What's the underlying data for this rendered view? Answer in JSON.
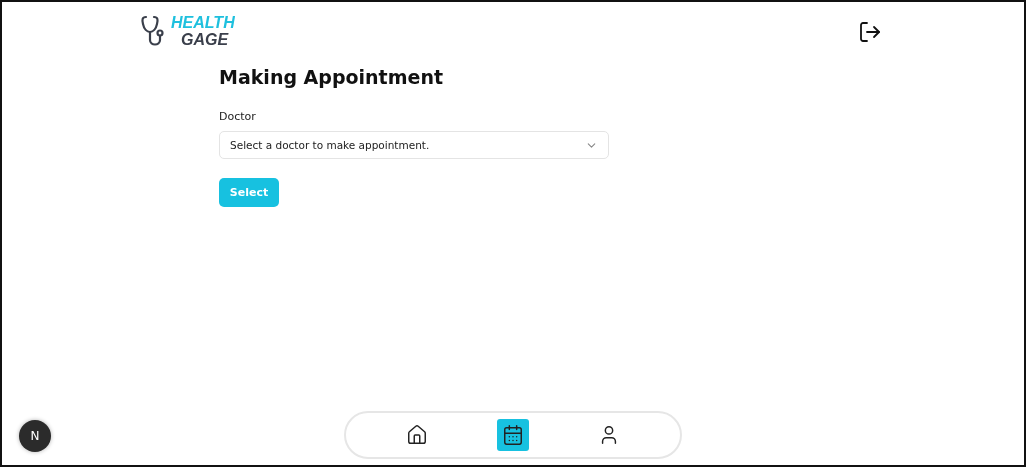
{
  "logo": {
    "line_1": "HEALTH",
    "line_2": "GAGE"
  },
  "title": "Making Appointment",
  "doctor_field": {
    "label": "Doctor",
    "placeholder": "Select a doctor to make appointment."
  },
  "select_button": "Select",
  "bottom_nav": [
    {
      "kind": "home",
      "selected": false
    },
    {
      "kind": "calendar",
      "selected": true
    },
    {
      "kind": "profile",
      "selected": false
    }
  ],
  "dev_badge": "N"
}
